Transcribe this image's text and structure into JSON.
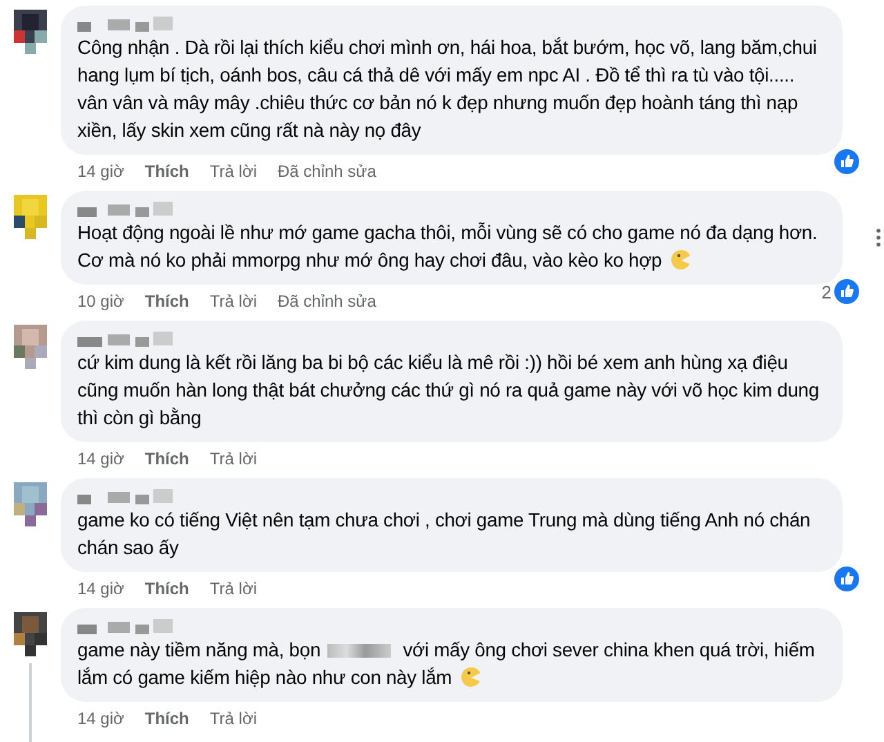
{
  "comments": [
    {
      "text": "Công nhận . Dà rồi lại thích kiểu chơi mình ơn, hái hoa, bắt bướm, học võ, lang băm,chui hang lụm bí tịch, oánh bos, câu cá thả dê với mấy em npc AI . Đồ tể thì ra tù vào tội..... vân vân và mây mây .chiêu thức cơ bản nó k đẹp nhưng muốn đẹp hoành táng thì nạp xiền, lấy skin xem cũng rất nà này nọ đây",
      "time": "14 giờ",
      "like": "Thích",
      "reply": "Trả lời",
      "edited": "Đã chỉnh sửa",
      "has_emoji": false,
      "reaction": true,
      "more_menu": false,
      "thread_line": false
    },
    {
      "text": "Hoạt động ngoài lề như mớ game gacha thôi, mỗi vùng sẽ có cho game nó đa dạng hơn. Cơ mà nó ko phải mmorpg như mớ ông hay chơi đâu, vào kèo ko hợp",
      "time": "10 giờ",
      "like": "Thích",
      "reply": "Trả lời",
      "edited": "Đã chỉnh sửa",
      "has_emoji": true,
      "reaction": true,
      "reaction_count": "2",
      "more_menu": true,
      "thread_line": false
    },
    {
      "text": "cứ kim dung là kết rồi lăng ba bi bộ các kiểu là mê rồi :)) hồi bé xem anh hùng xạ điệu cũng muốn hàn long thật bát chưởng các thứ gì nó ra quả game này với võ học kim dung thì còn gì bằng",
      "time": "14 giờ",
      "like": "Thích",
      "reply": "Trả lời",
      "has_emoji": false,
      "reaction": false,
      "more_menu": false,
      "thread_line": false
    },
    {
      "text": "game ko có tiếng Việt nên tạm chưa chơi , chơi game Trung mà dùng tiếng Anh nó chán chán sao ấy",
      "time": "14 giờ",
      "like": "Thích",
      "reply": "Trả lời",
      "has_emoji": false,
      "reaction": true,
      "more_menu": false,
      "thread_line": false
    },
    {
      "text": "game này tiềm năng mà, bọn",
      "text_after_redaction": "với mấy ông chơi sever china khen quá trời, hiếm lắm có game kiếm hiệp nào như con này lắm",
      "time": "14 giờ",
      "like": "Thích",
      "reply": "Trả lời",
      "has_emoji": true,
      "reaction": false,
      "more_menu": false,
      "thread_line": true
    }
  ]
}
